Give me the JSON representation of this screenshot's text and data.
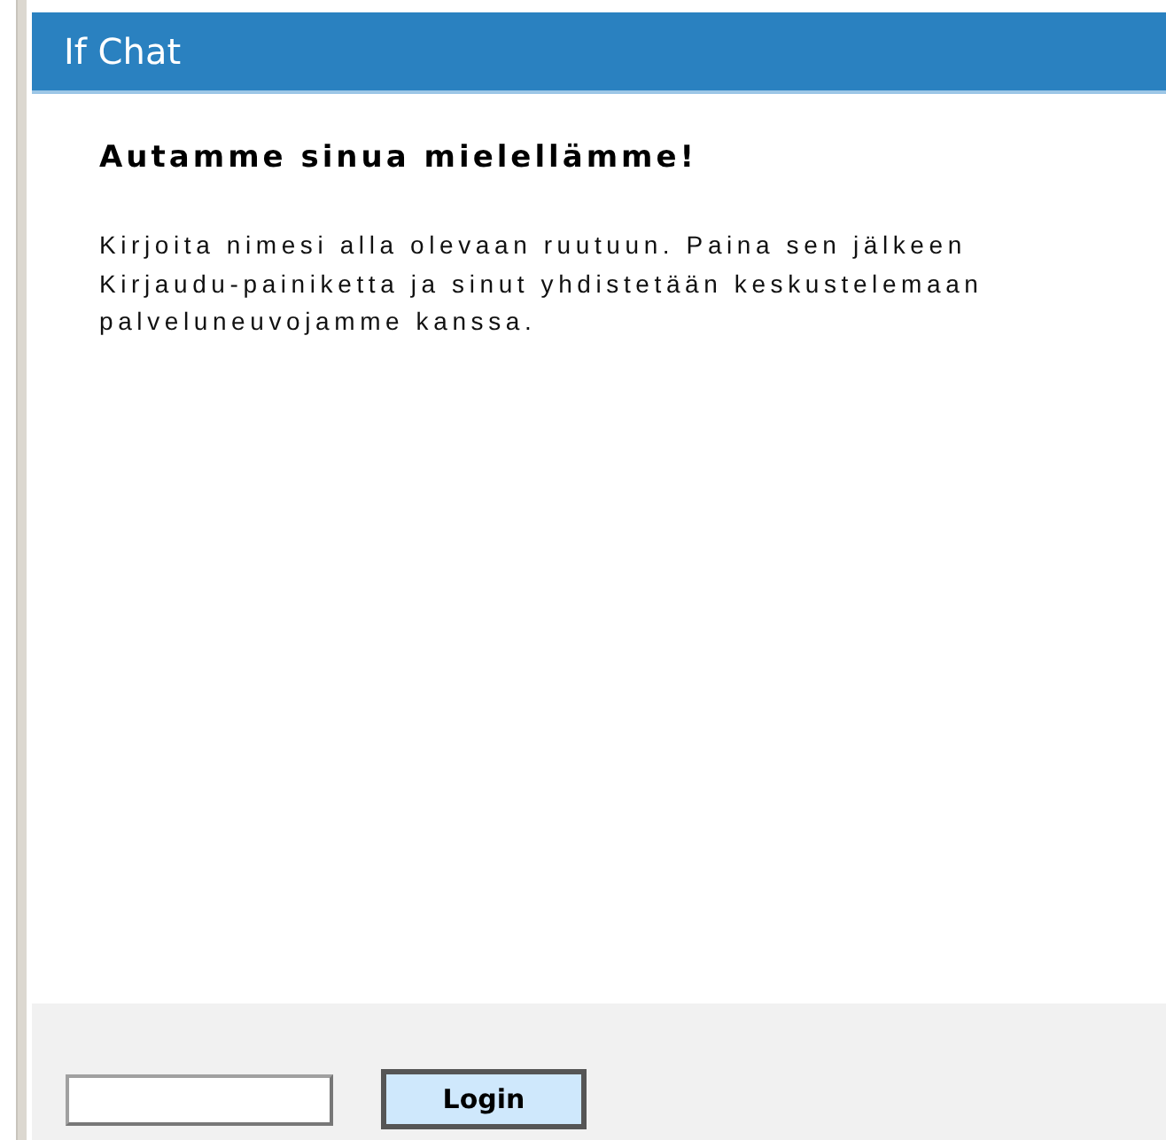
{
  "window": {
    "title": "If Chat"
  },
  "content": {
    "heading": "Autamme sinua mielellämme!",
    "paragraph": "Kirjoita nimesi alla olevaan ruutuun. Paina sen jälkeen Kirjaudu-painiketta ja sinut yhdistetään keskustelemaan palveluneuvojamme kanssa."
  },
  "footer": {
    "button": "Login"
  }
}
